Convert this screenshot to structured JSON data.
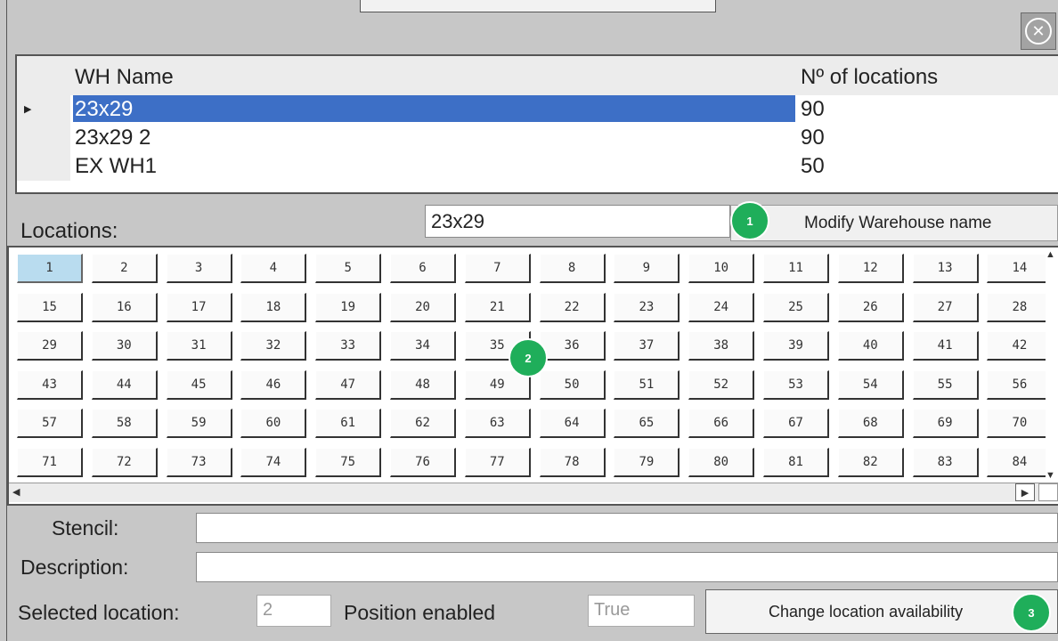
{
  "close_icon": "close-circle-icon",
  "warehouse_table": {
    "headers": {
      "name": "WH Name",
      "count": "Nº of locations"
    },
    "rows": [
      {
        "name": "23x29",
        "count": "90",
        "selected": true
      },
      {
        "name": "23x29  2",
        "count": "90",
        "selected": false
      },
      {
        "name": "EX WH1",
        "count": "50",
        "selected": false
      }
    ]
  },
  "locations": {
    "label": "Locations:",
    "warehouse_name_value": "23x29",
    "modify_button_label": "Modify Warehouse name",
    "selected_number": "1",
    "numbers": [
      "1",
      "2",
      "3",
      "4",
      "5",
      "6",
      "7",
      "8",
      "9",
      "10",
      "11",
      "12",
      "13",
      "14",
      "15",
      "16",
      "17",
      "18",
      "19",
      "20",
      "21",
      "22",
      "23",
      "24",
      "25",
      "26",
      "27",
      "28",
      "29",
      "30",
      "31",
      "32",
      "33",
      "34",
      "35",
      "36",
      "37",
      "38",
      "39",
      "40",
      "41",
      "42",
      "43",
      "44",
      "45",
      "46",
      "47",
      "48",
      "49",
      "50",
      "51",
      "52",
      "53",
      "54",
      "55",
      "56",
      "57",
      "58",
      "59",
      "60",
      "61",
      "62",
      "63",
      "64",
      "65",
      "66",
      "67",
      "68",
      "69",
      "70",
      "71",
      "72",
      "73",
      "74",
      "75",
      "76",
      "77",
      "78",
      "79",
      "80",
      "81",
      "82",
      "83",
      "84"
    ]
  },
  "badges": {
    "one": "1",
    "two": "2",
    "three": "3"
  },
  "details": {
    "stencil_label": "Stencil:",
    "stencil_value": "",
    "description_label": "Description:",
    "description_value": "",
    "selected_location_label": "Selected location:",
    "selected_location_value": "2",
    "position_enabled_label": "Position enabled",
    "position_enabled_value": "True",
    "change_button_label": "Change location availability"
  },
  "colors": {
    "selection": "#3d6fc6",
    "badge": "#1fae5a",
    "active_cell": "#b9dcef"
  }
}
